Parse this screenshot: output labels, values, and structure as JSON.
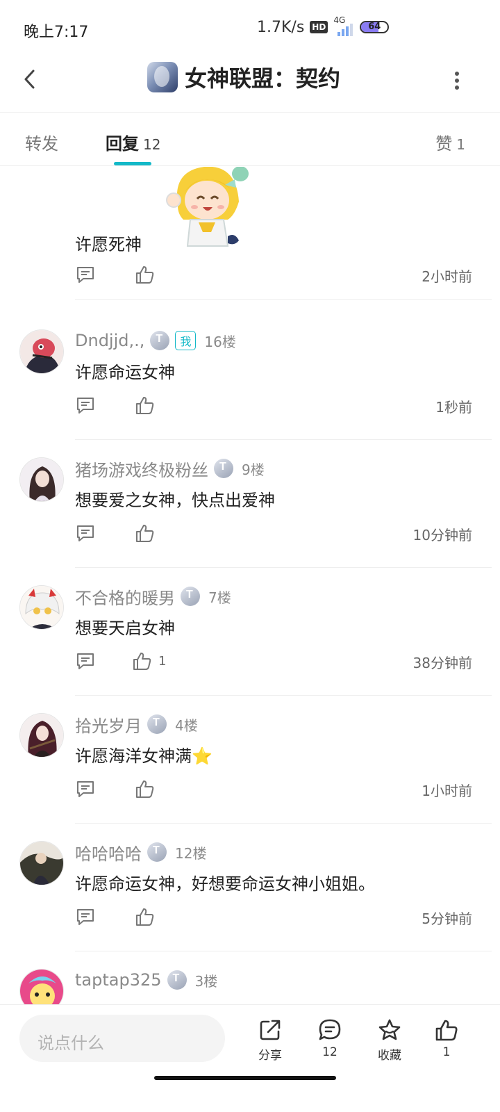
{
  "status_bar": {
    "time": "晚上7:17",
    "net_speed": "1.7K/s",
    "hd": "HD",
    "network": "4G",
    "battery": "64"
  },
  "header": {
    "title": "女神联盟：契约"
  },
  "tabs": {
    "forward": "转发",
    "reply": "回复",
    "reply_count": "12",
    "like": "赞",
    "like_count": "1"
  },
  "partial_post": {
    "content": "许愿死神",
    "time": "2小时前"
  },
  "comments": [
    {
      "username": "Dndjjd,.,",
      "me_badge": "我",
      "floor": "16楼",
      "content": "许愿命运女神",
      "likes": "",
      "time": "1秒前"
    },
    {
      "username": "猪场游戏终极粉丝",
      "floor": "9楼",
      "content": "想要爱之女神，快点出爱神",
      "likes": "",
      "time": "10分钟前"
    },
    {
      "username": "不合格的暖男",
      "floor": "7楼",
      "content": "想要天启女神",
      "likes": "1",
      "time": "38分钟前"
    },
    {
      "username": "拾光岁月",
      "floor": "4楼",
      "content": "许愿海洋女神满⭐",
      "likes": "",
      "time": "1小时前"
    },
    {
      "username": "哈哈哈哈",
      "floor": "12楼",
      "content": "许愿命运女神，好想要命运女神小姐姐。",
      "likes": "",
      "time": "5分钟前"
    },
    {
      "username": "taptap325",
      "floor": "3楼"
    }
  ],
  "bottom_bar": {
    "input_placeholder": "说点什么",
    "share": "分享",
    "comment_count": "12",
    "favorite": "收藏",
    "like_count": "1"
  },
  "colors": {
    "accent": "#14b9c8",
    "muted_text": "#8a8a8a",
    "divider": "#eeeeee"
  }
}
